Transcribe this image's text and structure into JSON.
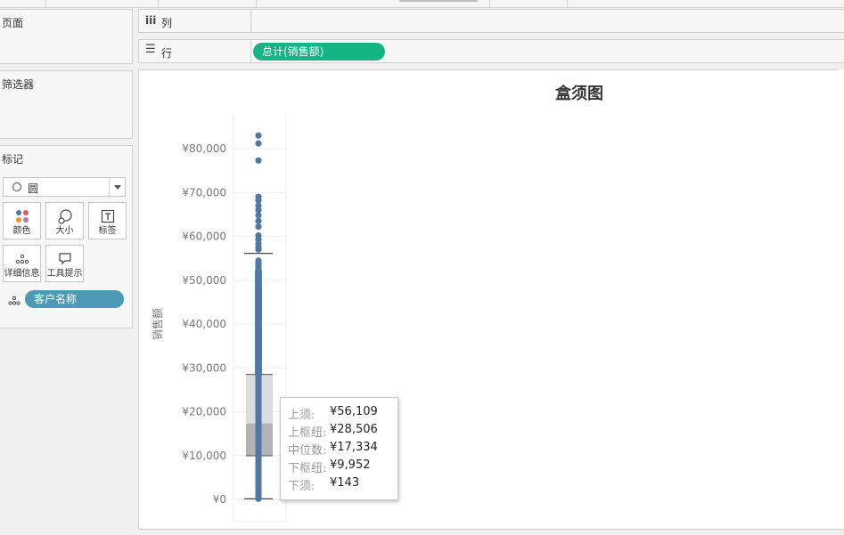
{
  "shelves": {
    "columns_label": "列",
    "rows_label": "行",
    "rows_pill": "总计(销售额)"
  },
  "panels": {
    "pages_title": "页面",
    "filters_title": "筛选器",
    "marks_title": "标记"
  },
  "marks": {
    "type_value": "圆",
    "buttons": [
      {
        "label": "颜色",
        "icon": "color-dots-icon"
      },
      {
        "label": "大小",
        "icon": "size-icon"
      },
      {
        "label": "标签",
        "icon": "label-text-icon"
      },
      {
        "label": "详细信息",
        "icon": "detail-dots-icon"
      },
      {
        "label": "工具提示",
        "icon": "tooltip-bubble-icon"
      }
    ],
    "detail_pill": "客户名称"
  },
  "chart_data": {
    "type": "boxplot",
    "title": "盒须图",
    "ylabel": "销售额",
    "ylim": [
      0,
      85000
    ],
    "yticks": [
      {
        "value": 0,
        "label": "¥0"
      },
      {
        "value": 10000,
        "label": "¥10,000"
      },
      {
        "value": 20000,
        "label": "¥20,000"
      },
      {
        "value": 30000,
        "label": "¥30,000"
      },
      {
        "value": 40000,
        "label": "¥40,000"
      },
      {
        "value": 50000,
        "label": "¥50,000"
      },
      {
        "value": 60000,
        "label": "¥60,000"
      },
      {
        "value": 70000,
        "label": "¥70,000"
      },
      {
        "value": 80000,
        "label": "¥80,000"
      }
    ],
    "box": {
      "upper_whisker": 56109,
      "upper_hinge": 28506,
      "median": 17334,
      "lower_hinge": 9952,
      "lower_whisker": 143
    },
    "outliers": [
      83000,
      81200,
      77300,
      69000,
      68200,
      67000,
      66000,
      64800,
      63500,
      62200,
      60200,
      59300,
      58400,
      57600,
      57000
    ],
    "dot_color": "#4e79a7",
    "tooltip": [
      {
        "key": "上须:",
        "value": "¥56,109"
      },
      {
        "key": "上枢纽:",
        "value": "¥28,506"
      },
      {
        "key": "中位数:",
        "value": "¥17,334"
      },
      {
        "key": "下枢纽:",
        "value": "¥9,952"
      },
      {
        "key": "下须:",
        "value": "¥143"
      }
    ]
  }
}
